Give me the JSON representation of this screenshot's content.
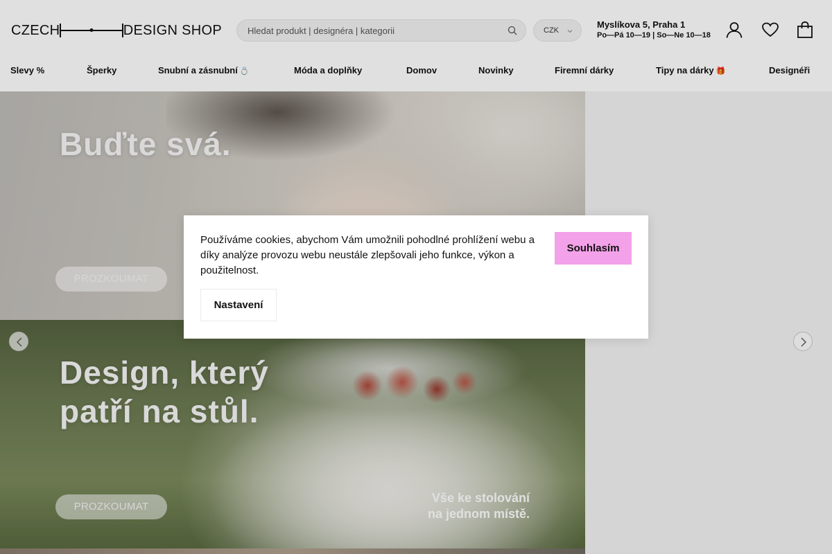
{
  "header": {
    "logo": {
      "left": "CZECH",
      "right": "DESIGN SHOP"
    },
    "search": {
      "placeholder": "Hledat produkt | designéra | kategorii"
    },
    "currency": {
      "selected": "CZK"
    },
    "store": {
      "address": "Myslíkova 5, Praha 1",
      "hours": "Po—Pá 10—19 | So—Ne 10—18"
    },
    "icons": [
      "user-icon",
      "heart-icon",
      "shopping-bag-icon",
      "search-icon",
      "chevron-down-icon"
    ]
  },
  "nav": {
    "items": [
      {
        "label": "Slevy %"
      },
      {
        "label": "Šperky"
      },
      {
        "label": "Snubní a zásnubní",
        "emoji": "💍"
      },
      {
        "label": "Móda a doplňky"
      },
      {
        "label": "Domov"
      },
      {
        "label": "Novinky"
      },
      {
        "label": "Firemní dárky"
      },
      {
        "label": "Tipy na dárky",
        "emoji": "🎁"
      },
      {
        "label": "Designéři"
      }
    ]
  },
  "hero": {
    "slides": [
      {
        "title": "Buďte svá.",
        "cta": "PROZKOUMAT"
      },
      {
        "title": "Design, který patří na stůl.",
        "cta": "PROZKOUMAT",
        "caption_line1": "Vše ke stolování",
        "caption_line2": "na jednom místě."
      }
    ]
  },
  "cookie": {
    "text": "Používáme cookies, abychom Vám umožnili pohodlné prohlížení webu a díky analýze provozu webu neustále zlepšovali jeho funkce, výkon a použitelnost.",
    "accept_label": "Souhlasím",
    "settings_label": "Nastavení"
  },
  "colors": {
    "accept_button": "#f3a1e9",
    "text": "#111111",
    "search_bg": "#f2f2f2"
  }
}
